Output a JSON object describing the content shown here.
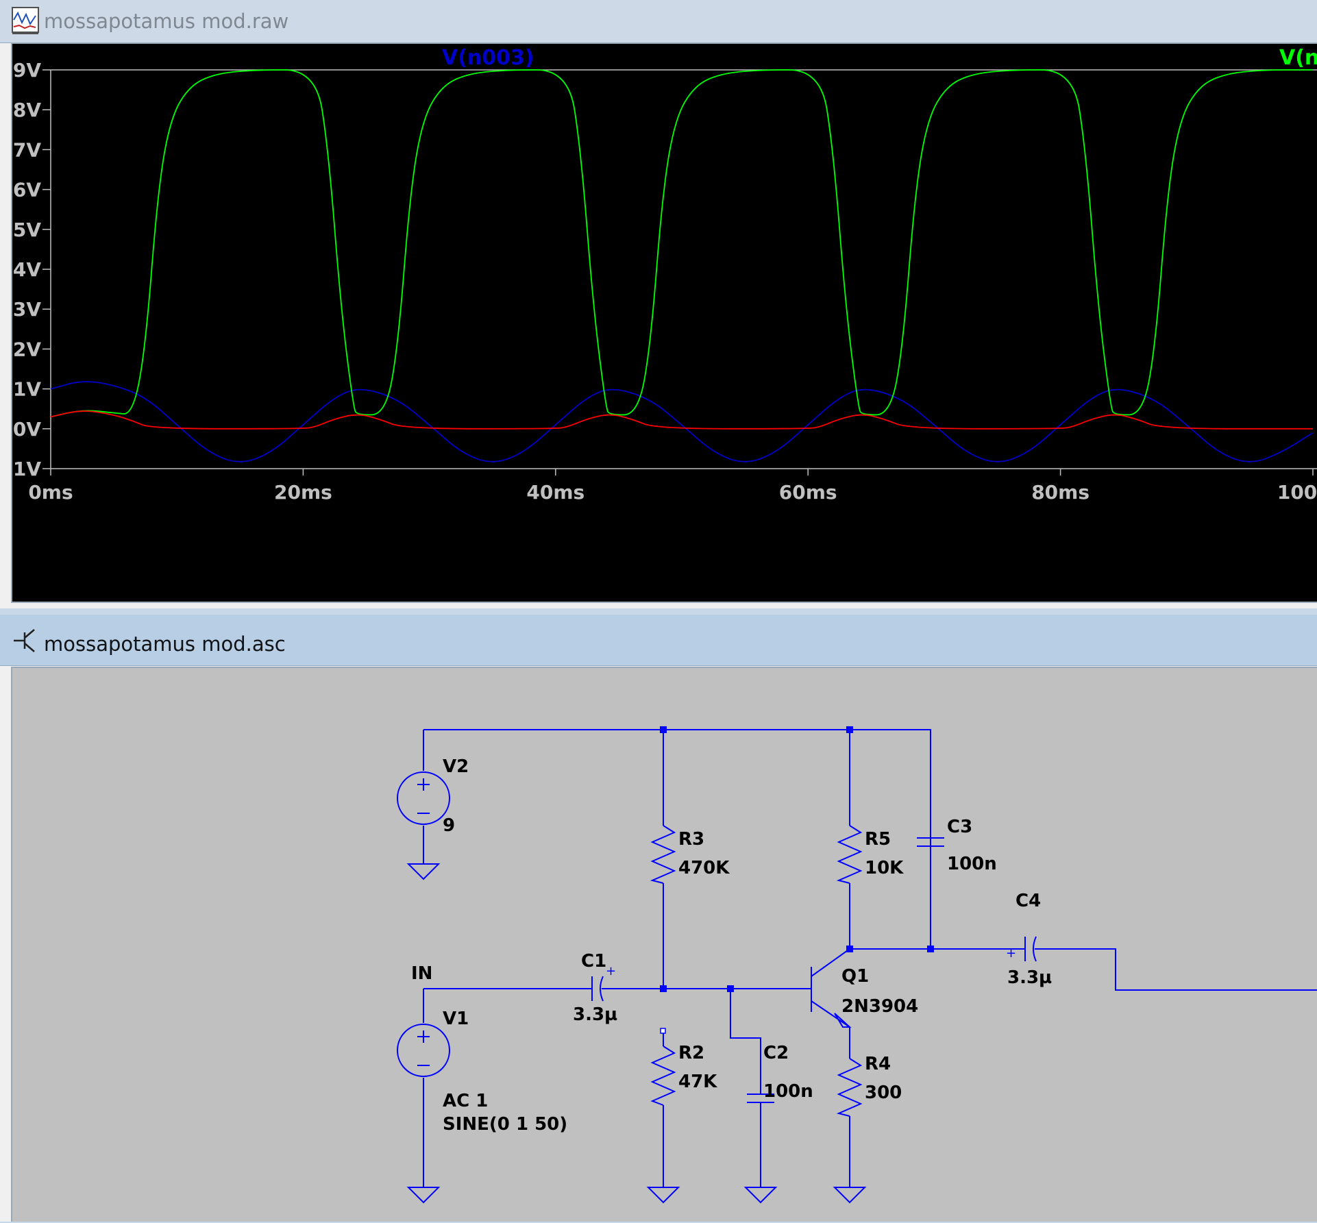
{
  "waveform_window": {
    "title": "mossapotamus mod.raw",
    "icon": "waveform-plot-icon",
    "trace_labels": {
      "blue": "V(n003)",
      "green": "V(n"
    }
  },
  "schematic_window": {
    "title": "mossapotamus mod.asc",
    "icon": "transistor-symbol-icon",
    "labels": {
      "V2": "V2",
      "V2_val": "9",
      "V1": "V1",
      "V1_val1": "AC 1",
      "V1_val2": "SINE(0 1 50)",
      "IN": "IN",
      "C1": "C1",
      "C1_val": "3.3µ",
      "R3": "R3",
      "R3_val": "470K",
      "R2": "R2",
      "R2_val": "47K",
      "C2": "C2",
      "C2_val": "100n",
      "R5": "R5",
      "R5_val": "10K",
      "C3": "C3",
      "C3_val": "100n",
      "C4": "C4",
      "C4_val": "3.3µ",
      "Q1": "Q1",
      "Q1_val": "2N3904",
      "R4": "R4",
      "R4_val": "300"
    }
  },
  "colors": {
    "blue_trace": "#0000c8",
    "green_trace": "#00ff00",
    "red_trace": "#ff0000",
    "yellow_trace": "#e0e000",
    "schematic_wire": "#0000ff",
    "junction": "#0000ff",
    "text_label": "#000000",
    "axis_text": "#c0c0c0"
  },
  "chart_data": {
    "type": "line",
    "x_unit": "ms",
    "y_unit": "V",
    "xlim": [
      0,
      100
    ],
    "ylim": [
      -1,
      9
    ],
    "x_ticks": [
      "0ms",
      "20ms",
      "40ms",
      "60ms",
      "80ms",
      "100ms"
    ],
    "y_ticks": [
      "9V",
      "8V",
      "7V",
      "6V",
      "5V",
      "4V",
      "3V",
      "2V",
      "1V",
      "0V",
      "-1V"
    ],
    "grid": false,
    "legend": "top",
    "series": [
      {
        "name": "V(n003)",
        "color": "#0000c8",
        "x": [
          0,
          2.5,
          5,
          7.5,
          10,
          12.5,
          15,
          17.5,
          20,
          22.5,
          24.5,
          27.5,
          30,
          32.5,
          35,
          37.5,
          40,
          42.5,
          44.5,
          47.5,
          50,
          52.5,
          55,
          57.5,
          60,
          62.5,
          64.5,
          67.5,
          70,
          72.5,
          75,
          77.5,
          80,
          82.5,
          84.5,
          87.5,
          90,
          92.5,
          95,
          97.5,
          100
        ],
        "y": [
          1.0,
          1.22,
          1.1,
          0.8,
          0.1,
          -0.6,
          -0.9,
          -0.6,
          0.1,
          0.8,
          1.05,
          0.75,
          0.1,
          -0.6,
          -0.9,
          -0.6,
          0.1,
          0.8,
          1.05,
          0.75,
          0.1,
          -0.6,
          -0.9,
          -0.6,
          0.1,
          0.8,
          1.05,
          0.75,
          0.1,
          -0.6,
          -0.9,
          -0.6,
          0.1,
          0.8,
          1.05,
          0.75,
          0.1,
          -0.6,
          -0.9,
          -0.6,
          -0.1
        ]
      },
      {
        "name": "V(n",
        "color": "#00ff00",
        "x": [
          0,
          2.5,
          5,
          6.5,
          7.5,
          8.5,
          9.5,
          11,
          13,
          16,
          21,
          22,
          23,
          24,
          24.3,
          26.5,
          27.5,
          28.5,
          29.5,
          31,
          33,
          36,
          41,
          42,
          43,
          44,
          44.3,
          46.5,
          47.5,
          48.5,
          49.5,
          51,
          53,
          56,
          61,
          62,
          63,
          64,
          64.3,
          66.5,
          67.5,
          68.5,
          69.5,
          71,
          73,
          76,
          81,
          82,
          83,
          84,
          84.3,
          86.5,
          87.5,
          88.5,
          89.5,
          91,
          93,
          96,
          100
        ],
        "y": [
          0.3,
          0.48,
          0.4,
          0.35,
          2.0,
          6.0,
          7.8,
          8.6,
          8.9,
          9.0,
          9.0,
          7.0,
          3.0,
          0.5,
          0.35,
          0.35,
          2.0,
          6.0,
          7.8,
          8.6,
          8.9,
          9.0,
          9.0,
          7.0,
          3.0,
          0.5,
          0.35,
          0.35,
          2.0,
          6.0,
          7.8,
          8.6,
          8.9,
          9.0,
          9.0,
          7.0,
          3.0,
          0.5,
          0.35,
          0.35,
          2.0,
          6.0,
          7.8,
          8.6,
          8.9,
          9.0,
          9.0,
          7.0,
          3.0,
          0.5,
          0.35,
          0.35,
          2.0,
          6.0,
          7.8,
          8.6,
          8.9,
          9.0,
          9.0
        ]
      },
      {
        "name": "",
        "color": "#ff0000",
        "x": [
          0,
          2.5,
          5,
          6.5,
          8,
          20,
          21,
          22.5,
          24.3,
          26,
          28,
          40,
          41,
          42.5,
          44.3,
          46,
          48,
          60,
          61,
          62.5,
          64.3,
          66,
          68,
          80,
          81,
          82.5,
          84.3,
          86,
          88,
          100
        ],
        "y": [
          0.3,
          0.48,
          0.35,
          0.2,
          0.0,
          0.0,
          0.05,
          0.25,
          0.38,
          0.25,
          0.0,
          0.0,
          0.05,
          0.25,
          0.38,
          0.25,
          0.0,
          0.0,
          0.05,
          0.25,
          0.38,
          0.25,
          0.0,
          0.0,
          0.05,
          0.25,
          0.38,
          0.25,
          0.0,
          0.0
        ]
      }
    ]
  }
}
